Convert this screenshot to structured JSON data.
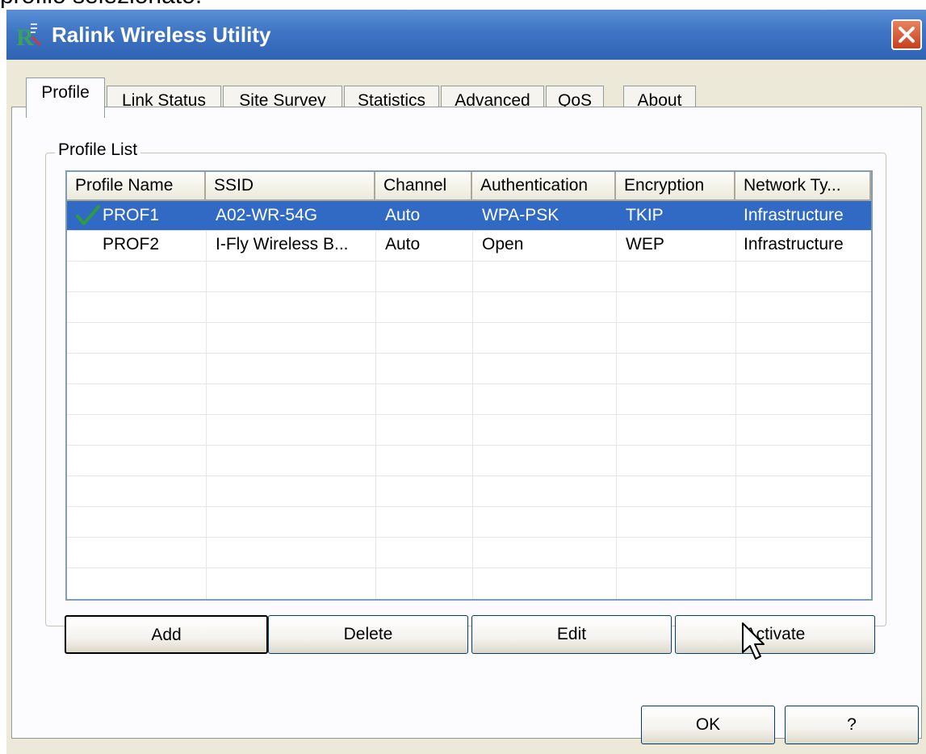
{
  "caption": "profilo selezionato.",
  "window": {
    "title": "Ralink Wireless Utility"
  },
  "tabs": [
    {
      "label": "Profile",
      "active": true
    },
    {
      "label": "Link Status",
      "active": false
    },
    {
      "label": "Site Survey",
      "active": false
    },
    {
      "label": "Statistics",
      "active": false
    },
    {
      "label": "Advanced",
      "active": false
    },
    {
      "label": "QoS",
      "active": false
    },
    {
      "label": "About",
      "active": false
    }
  ],
  "profile_list": {
    "group_label": "Profile List",
    "columns": [
      "Profile Name",
      "SSID",
      "Channel",
      "Authentication",
      "Encryption",
      "Network Ty..."
    ],
    "rows": [
      {
        "name": "PROF1",
        "ssid": "A02-WR-54G",
        "channel": "Auto",
        "authentication": "WPA-PSK",
        "encryption": "TKIP",
        "network_type": "Infrastructure",
        "active": true,
        "selected": true
      },
      {
        "name": "PROF2",
        "ssid": "I-Fly Wireless B...",
        "channel": "Auto",
        "authentication": "Open",
        "encryption": "WEP",
        "network_type": "Infrastructure",
        "active": false,
        "selected": false
      }
    ]
  },
  "buttons": {
    "add": "Add",
    "delete": "Delete",
    "edit": "Edit",
    "activate": "Activate"
  },
  "footer": {
    "ok": "OK",
    "help": "?"
  },
  "colors": {
    "titlebar": "#3f74c4",
    "selection": "#316ac5",
    "window_bg": "#ece9d8",
    "check": "#2e9c3c",
    "close": "#d9542b"
  },
  "icons": {
    "app": "ralink-icon",
    "close": "close-icon",
    "active_profile": "checkmark-icon",
    "pointer": "mouse-pointer-icon"
  }
}
